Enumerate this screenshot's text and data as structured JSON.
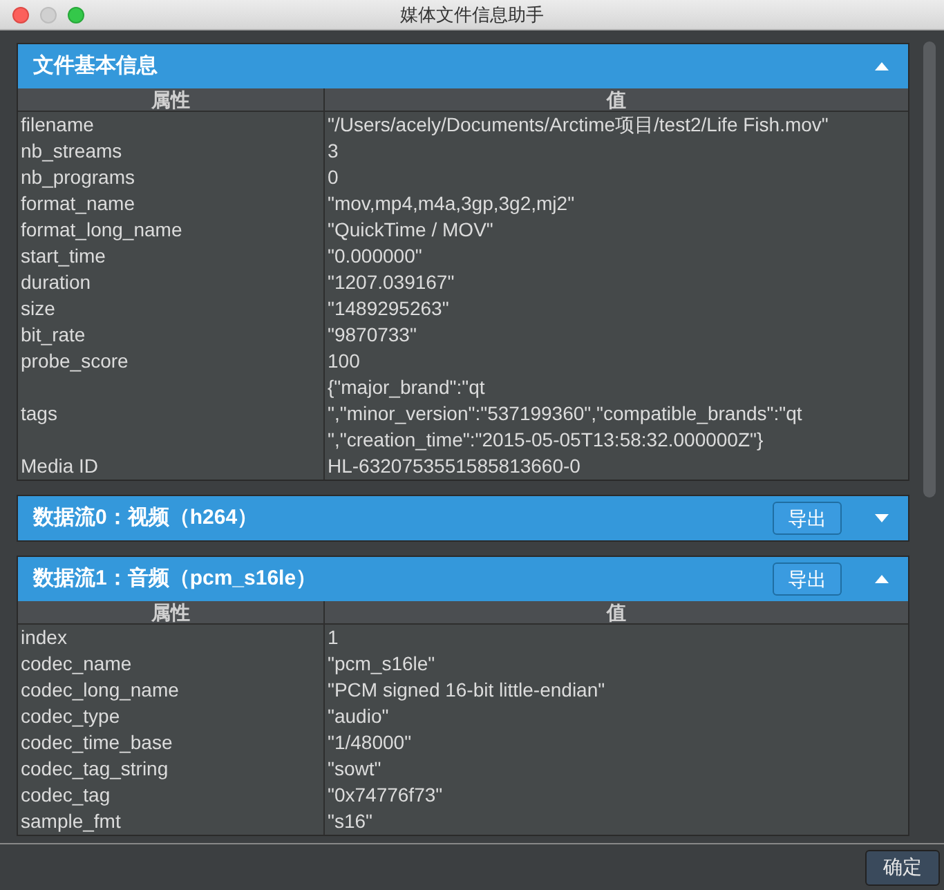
{
  "window": {
    "title": "媒体文件信息助手"
  },
  "sections": [
    {
      "title": "文件基本信息",
      "expanded": true,
      "columns": [
        "属性",
        "值"
      ],
      "rows": [
        {
          "name": "filename",
          "value": "\"/Users/acely/Documents/Arctime项目/test2/Life Fish.mov\""
        },
        {
          "name": "nb_streams",
          "value": "3"
        },
        {
          "name": "nb_programs",
          "value": "0"
        },
        {
          "name": "format_name",
          "value": "\"mov,mp4,m4a,3gp,3g2,mj2\""
        },
        {
          "name": "format_long_name",
          "value": "\"QuickTime / MOV\""
        },
        {
          "name": "start_time",
          "value": "\"0.000000\""
        },
        {
          "name": "duration",
          "value": "\"1207.039167\""
        },
        {
          "name": "size",
          "value": "\"1489295263\""
        },
        {
          "name": "bit_rate",
          "value": "\"9870733\""
        },
        {
          "name": "probe_score",
          "value": "100"
        },
        {
          "name": "tags",
          "value": "{\"major_brand\":\"qt\n\",\"minor_version\":\"537199360\",\"compatible_brands\":\"qt\n\",\"creation_time\":\"2015-05-05T13:58:32.000000Z\"}"
        },
        {
          "name": "Media ID",
          "value": "HL-6320753551585813660-0"
        }
      ]
    },
    {
      "title": "数据流0：视频（h264）",
      "expanded": false,
      "export_label": "导出"
    },
    {
      "title": "数据流1：音频（pcm_s16le）",
      "expanded": true,
      "export_label": "导出",
      "columns": [
        "属性",
        "值"
      ],
      "rows": [
        {
          "name": "index",
          "value": "1"
        },
        {
          "name": "codec_name",
          "value": "\"pcm_s16le\""
        },
        {
          "name": "codec_long_name",
          "value": "\"PCM signed 16-bit little-endian\""
        },
        {
          "name": "codec_type",
          "value": "\"audio\""
        },
        {
          "name": "codec_time_base",
          "value": "\"1/48000\""
        },
        {
          "name": "codec_tag_string",
          "value": "\"sowt\""
        },
        {
          "name": "codec_tag",
          "value": "\"0x74776f73\""
        },
        {
          "name": "sample_fmt",
          "value": "\"s16\""
        }
      ]
    }
  ],
  "ok_button": "确定"
}
